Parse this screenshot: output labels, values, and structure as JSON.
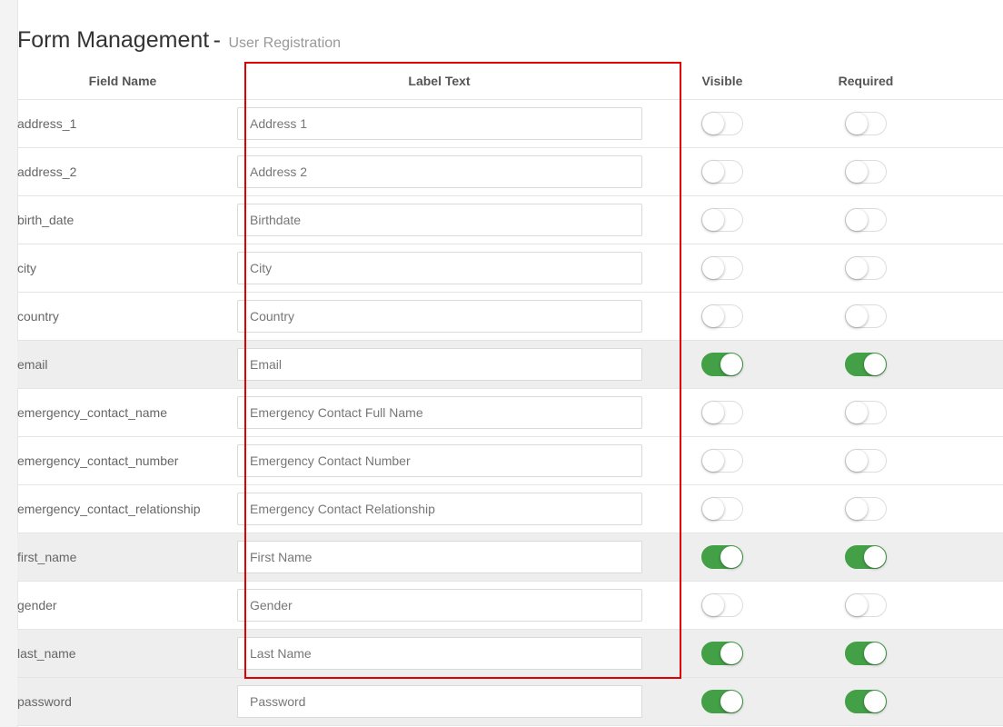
{
  "page": {
    "title": "Form Management",
    "separator": "-",
    "subtitle": "User Registration"
  },
  "table": {
    "headers": [
      "Field Name",
      "Label Text",
      "Visible",
      "Required"
    ],
    "rows": [
      {
        "field": "address_1",
        "label": "Address 1",
        "visible": false,
        "required": false
      },
      {
        "field": "address_2",
        "label": "Address 2",
        "visible": false,
        "required": false
      },
      {
        "field": "birth_date",
        "label": "Birthdate",
        "visible": false,
        "required": false
      },
      {
        "field": "city",
        "label": "City",
        "visible": false,
        "required": false
      },
      {
        "field": "country",
        "label": "Country",
        "visible": false,
        "required": false
      },
      {
        "field": "email",
        "label": "Email",
        "visible": true,
        "required": true
      },
      {
        "field": "emergency_contact_name",
        "label": "Emergency Contact Full Name",
        "visible": false,
        "required": false
      },
      {
        "field": "emergency_contact_number",
        "label": "Emergency Contact Number",
        "visible": false,
        "required": false
      },
      {
        "field": "emergency_contact_relationship",
        "label": "Emergency Contact Relationship",
        "visible": false,
        "required": false
      },
      {
        "field": "first_name",
        "label": "First Name",
        "visible": true,
        "required": true
      },
      {
        "field": "gender",
        "label": "Gender",
        "visible": false,
        "required": false
      },
      {
        "field": "last_name",
        "label": "Last Name",
        "visible": true,
        "required": true
      },
      {
        "field": "password",
        "label": "Password",
        "visible": true,
        "required": true
      }
    ]
  },
  "colors": {
    "toggle_on": "#43a047",
    "highlight_box": "#e00000",
    "highlighted_row": "#eeeeee"
  }
}
